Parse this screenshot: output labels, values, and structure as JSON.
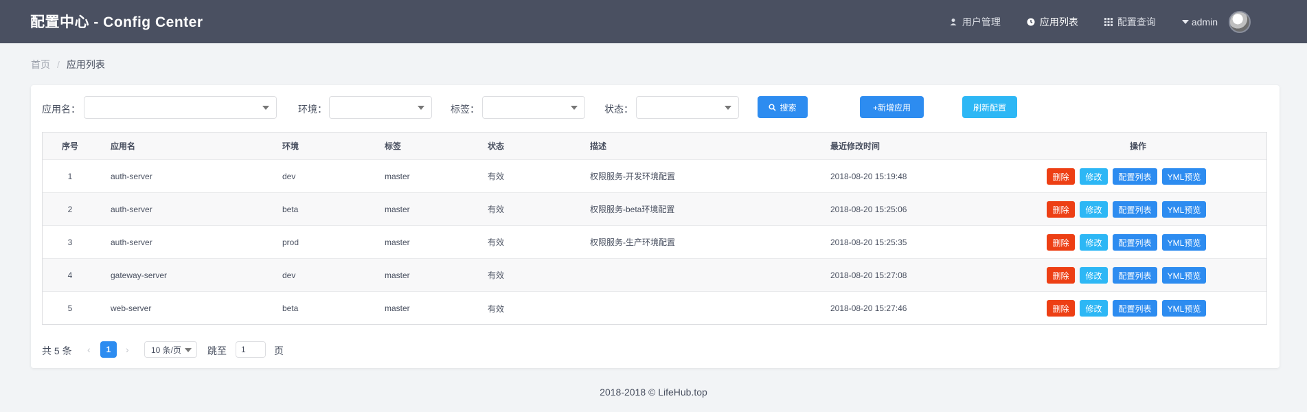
{
  "header": {
    "title": "配置中心 - Config Center",
    "nav": [
      {
        "label": "用户管理",
        "icon": "user-icon",
        "active": false
      },
      {
        "label": "应用列表",
        "icon": "app-list-icon",
        "active": true
      },
      {
        "label": "配置查询",
        "icon": "grid-icon",
        "active": false
      }
    ],
    "user": "admin"
  },
  "breadcrumb": {
    "home": "首页",
    "separator": "/",
    "current": "应用列表"
  },
  "filters": {
    "app_label": "应用名：",
    "env_label": "环境：",
    "tag_label": "标签：",
    "status_label": "状态：",
    "search_btn": "搜索",
    "add_btn": "+新增应用",
    "refresh_btn": "刷新配置"
  },
  "table": {
    "columns": [
      "序号",
      "应用名",
      "环境",
      "标签",
      "状态",
      "描述",
      "最近修改时间",
      "操作"
    ],
    "rows": [
      {
        "idx": "1",
        "app": "auth-server",
        "env": "dev",
        "tag": "master",
        "status": "有效",
        "desc": "权限服务-开发环境配置",
        "time": "2018-08-20 15:19:48"
      },
      {
        "idx": "2",
        "app": "auth-server",
        "env": "beta",
        "tag": "master",
        "status": "有效",
        "desc": "权限服务-beta环境配置",
        "time": "2018-08-20 15:25:06"
      },
      {
        "idx": "3",
        "app": "auth-server",
        "env": "prod",
        "tag": "master",
        "status": "有效",
        "desc": "权限服务-生产环境配置",
        "time": "2018-08-20 15:25:35"
      },
      {
        "idx": "4",
        "app": "gateway-server",
        "env": "dev",
        "tag": "master",
        "status": "有效",
        "desc": "",
        "time": "2018-08-20 15:27:08"
      },
      {
        "idx": "5",
        "app": "web-server",
        "env": "beta",
        "tag": "master",
        "status": "有效",
        "desc": "",
        "time": "2018-08-20 15:27:46"
      }
    ],
    "actions": {
      "delete": "删除",
      "edit": "修改",
      "config_list": "配置列表",
      "yml_preview": "YML预览"
    }
  },
  "pagination": {
    "total": "共 5 条",
    "prev": "‹",
    "current_page": "1",
    "next": "›",
    "page_size": "10 条/页",
    "jump_label": "跳至",
    "jump_value": "1",
    "page_unit": "页"
  },
  "footer": "2018-2018 © LifeHub.top",
  "colors": {
    "header_bg": "#4a5061",
    "primary": "#2d8cf0",
    "info": "#2db7f5",
    "danger": "#ed3f14"
  }
}
